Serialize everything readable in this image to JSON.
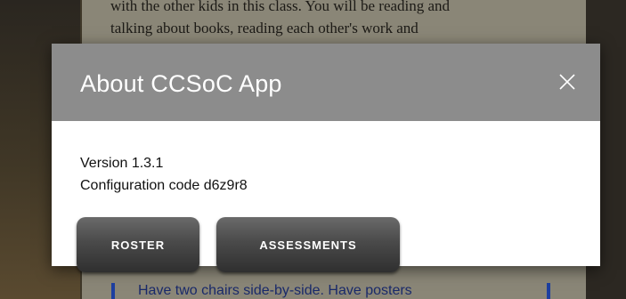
{
  "background": {
    "text_line_1": "with the other kids in this class. You will be reading and",
    "text_line_2": "talking about books, reading each other's work and",
    "bottom_text": "Have two chairs side-by-side. Have posters"
  },
  "dialog": {
    "title": "About CCSoC App",
    "version_text": "Version 1.3.1",
    "configuration_text": "Configuration code d6z9r8",
    "buttons": {
      "roster": "ROSTER",
      "assessments": "ASSESSMENTS"
    }
  },
  "colors": {
    "header": "#8c8c8c",
    "button": "#4a4a4a",
    "dialog_bg": "#ffffff"
  },
  "icons": {
    "close": "close-icon"
  }
}
